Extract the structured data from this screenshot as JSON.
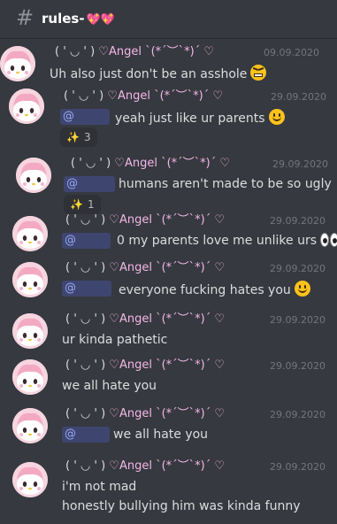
{
  "channel": {
    "hash": "#",
    "name": "rules-",
    "hearts": "💖💖"
  },
  "messages": [
    {
      "name_a": "( ' ◡ ' )",
      "name_b": " ♡Angel ",
      "name_c": "ˋ(*´︶`*)ˊ ♡",
      "timestamp": "09.09.2020",
      "lines": [
        "Uh also just don't be an asshole"
      ],
      "emoji": "angry-face"
    },
    {
      "name_a": "( ' ◡ ' )",
      "name_b": " ♡Angel ",
      "name_c": "ˋ(*´︶`*)ˊ ♡",
      "timestamp": "29.09.2020",
      "mention": "@",
      "lines": [
        "yeah just like ur parents"
      ],
      "emoji": "smile-face",
      "reaction": {
        "emoji": "✨",
        "count": "3"
      }
    },
    {
      "name_a": "( ' ◡ ' )",
      "name_b": " ♡Angel ",
      "name_c": "ˋ(*´︶`*)ˊ ♡",
      "timestamp": "29.09.2020",
      "mention": "@",
      "lines": [
        "humans aren't made to be so ugly"
      ],
      "reaction": {
        "emoji": "✨",
        "count": "1"
      }
    },
    {
      "name_a": "( ' ◡ ' )",
      "name_b": " ♡Angel ",
      "name_c": "ˋ(*´︶`*)ˊ ♡",
      "timestamp": "29.09.2020",
      "mention": "@",
      "lines": [
        "0 my parents love me unlike urs"
      ],
      "emoji": "eyes"
    },
    {
      "name_a": "( ' ◡ ' )",
      "name_b": " ♡Angel ",
      "name_c": "ˋ(*´︶`*)ˊ ♡",
      "timestamp": "29.09.2020",
      "mention": "@",
      "lines": [
        "everyone fucking hates you"
      ],
      "emoji": "smile-face"
    },
    {
      "name_a": "( ' ◡ ' )",
      "name_b": " ♡Angel ",
      "name_c": "ˋ(*´︶`*)ˊ ♡",
      "timestamp": "29.09.2020",
      "lines": [
        "ur kinda pathetic"
      ]
    },
    {
      "name_a": "( ' ◡ ' )",
      "name_b": " ♡Angel ",
      "name_c": "ˋ(*´︶`*)ˊ ♡",
      "timestamp": "29.09.2020",
      "lines": [
        "we all hate you"
      ]
    },
    {
      "name_a": "( ' ◡ ' )",
      "name_b": " ♡Angel ",
      "name_c": "ˋ(*´︶`*)ˊ ♡",
      "timestamp": "29.09.2020",
      "mention": "@",
      "lines": [
        "we all hate you"
      ]
    },
    {
      "name_a": "( ' ◡ ' )",
      "name_b": " ♡Angel ",
      "name_c": "ˋ(*´︶`*)ˊ ♡",
      "timestamp": "29.09.2020",
      "lines": [
        "i'm not mad",
        "honestly bullying him was kinda funny"
      ]
    }
  ]
}
